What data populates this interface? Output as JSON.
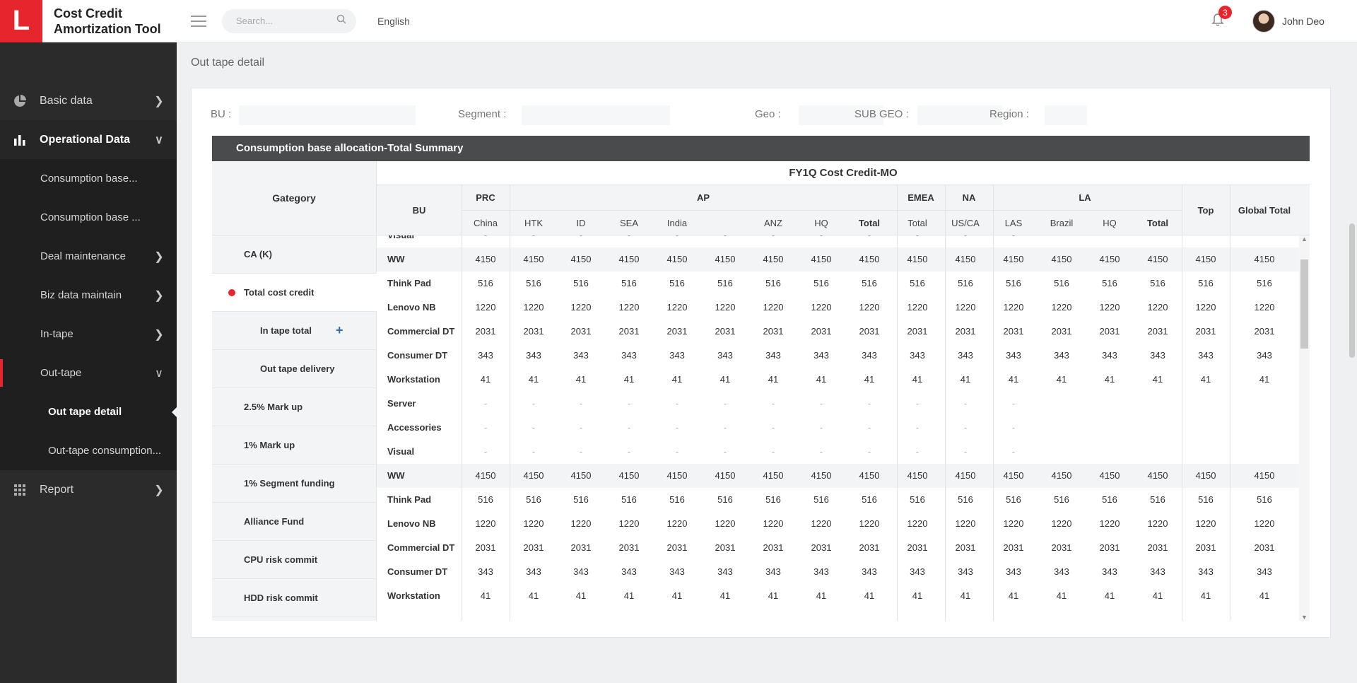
{
  "app": {
    "logo_letter": "L",
    "title": "Cost Credit Amortization Tool"
  },
  "topbar": {
    "search_placeholder": "Search...",
    "language": "English",
    "notifications": "3",
    "user_name": "John Deo"
  },
  "sidebar": {
    "basic_data": "Basic data",
    "operational_data": "Operational Data",
    "consumption_base_1": "Consumption base...",
    "consumption_base_2": "Consumption base ...",
    "deal_maintenance": "Deal maintenance",
    "biz_data_maintain": "Biz data maintain",
    "in_tape": "In-tape",
    "out_tape": "Out-tape",
    "out_tape_detail": "Out tape detail",
    "out_tape_consumption": "Out-tape consumption...",
    "report": "Report"
  },
  "page": {
    "title": "Out tape detail"
  },
  "filters": {
    "bu": "BU :",
    "segment": "Segment :",
    "geo": "Geo :",
    "sub_geo": "SUB GEO :",
    "region": "Region :"
  },
  "summary": {
    "title": "Consumption base allocation-Total Summary"
  },
  "categories": {
    "header": "Gategory",
    "items": [
      "CA (K)",
      "Total cost credit",
      "In tape total",
      "Out tape delivery",
      "2.5% Mark up",
      "1% Mark up",
      "1% Segment funding",
      "Alliance Fund",
      "CPU risk commit",
      "HDD risk commit"
    ],
    "add_symbol": "+"
  },
  "table": {
    "period_title": "FY1Q Cost Credit-MO",
    "bu_header": "BU",
    "group_headers": [
      "PRC",
      "AP",
      "EMEA",
      "NA",
      "LA"
    ],
    "top_header": "Top",
    "global_total_header": "Global Total",
    "sub_headers": [
      "China",
      "HTK",
      "ID",
      "SEA",
      "India",
      "ANZ",
      "HQ",
      "Total",
      "Total",
      "US/CA",
      "LAS",
      "Brazil",
      "HQ",
      "Total"
    ],
    "rows": [
      {
        "label": "Visual",
        "values": [
          "-",
          "-",
          "-",
          "-",
          "-",
          "-",
          "-",
          "-",
          "-",
          "-",
          "-",
          "-",
          "",
          "",
          "",
          "",
          "",
          ""
        ]
      },
      {
        "label": "WW",
        "ww": true,
        "values": [
          "4150",
          "4150",
          "4150",
          "4150",
          "4150",
          "4150",
          "4150",
          "4150",
          "4150",
          "4150",
          "4150",
          "4150",
          "4150",
          "4150",
          "4150",
          "4150",
          "4150"
        ]
      },
      {
        "label": "Think Pad",
        "values": [
          "516",
          "516",
          "516",
          "516",
          "516",
          "516",
          "516",
          "516",
          "516",
          "516",
          "516",
          "516",
          "516",
          "516",
          "516",
          "516",
          "516"
        ]
      },
      {
        "label": "Lenovo NB",
        "values": [
          "1220",
          "1220",
          "1220",
          "1220",
          "1220",
          "1220",
          "1220",
          "1220",
          "1220",
          "1220",
          "1220",
          "1220",
          "1220",
          "1220",
          "1220",
          "1220",
          "1220"
        ]
      },
      {
        "label": "Commercial DT",
        "values": [
          "2031",
          "2031",
          "2031",
          "2031",
          "2031",
          "2031",
          "2031",
          "2031",
          "2031",
          "2031",
          "2031",
          "2031",
          "2031",
          "2031",
          "2031",
          "2031",
          "2031"
        ]
      },
      {
        "label": "Consumer DT",
        "values": [
          "343",
          "343",
          "343",
          "343",
          "343",
          "343",
          "343",
          "343",
          "343",
          "343",
          "343",
          "343",
          "343",
          "343",
          "343",
          "343",
          "343"
        ]
      },
      {
        "label": "Workstation",
        "values": [
          "41",
          "41",
          "41",
          "41",
          "41",
          "41",
          "41",
          "41",
          "41",
          "41",
          "41",
          "41",
          "41",
          "41",
          "41",
          "41",
          "41"
        ]
      },
      {
        "label": "Server",
        "values": [
          "-",
          "-",
          "-",
          "-",
          "-",
          "-",
          "-",
          "-",
          "-",
          "-",
          "-",
          "-",
          "",
          "",
          "",
          "",
          ""
        ]
      },
      {
        "label": "Accessories",
        "values": [
          "-",
          "-",
          "-",
          "-",
          "-",
          "-",
          "-",
          "-",
          "-",
          "-",
          "-",
          "-",
          "",
          "",
          "",
          "",
          ""
        ]
      },
      {
        "label": "Visual",
        "values": [
          "-",
          "-",
          "-",
          "-",
          "-",
          "-",
          "-",
          "-",
          "-",
          "-",
          "-",
          "-",
          "",
          "",
          "",
          "",
          ""
        ]
      },
      {
        "label": "WW",
        "ww": true,
        "values": [
          "4150",
          "4150",
          "4150",
          "4150",
          "4150",
          "4150",
          "4150",
          "4150",
          "4150",
          "4150",
          "4150",
          "4150",
          "4150",
          "4150",
          "4150",
          "4150",
          "4150"
        ]
      },
      {
        "label": "Think Pad",
        "values": [
          "516",
          "516",
          "516",
          "516",
          "516",
          "516",
          "516",
          "516",
          "516",
          "516",
          "516",
          "516",
          "516",
          "516",
          "516",
          "516",
          "516"
        ]
      },
      {
        "label": "Lenovo NB",
        "values": [
          "1220",
          "1220",
          "1220",
          "1220",
          "1220",
          "1220",
          "1220",
          "1220",
          "1220",
          "1220",
          "1220",
          "1220",
          "1220",
          "1220",
          "1220",
          "1220",
          "1220"
        ]
      },
      {
        "label": "Commercial DT",
        "values": [
          "2031",
          "2031",
          "2031",
          "2031",
          "2031",
          "2031",
          "2031",
          "2031",
          "2031",
          "2031",
          "2031",
          "2031",
          "2031",
          "2031",
          "2031",
          "2031",
          "2031"
        ]
      },
      {
        "label": "Consumer DT",
        "values": [
          "343",
          "343",
          "343",
          "343",
          "343",
          "343",
          "343",
          "343",
          "343",
          "343",
          "343",
          "343",
          "343",
          "343",
          "343",
          "343",
          "343"
        ]
      },
      {
        "label": "Workstation",
        "values": [
          "41",
          "41",
          "41",
          "41",
          "41",
          "41",
          "41",
          "41",
          "41",
          "41",
          "41",
          "41",
          "41",
          "41",
          "41",
          "41",
          "41"
        ]
      }
    ]
  },
  "colors": {
    "accent": "#e6262c",
    "sidebar_bg": "#2b2b2b",
    "header_bar": "#4a4b4d",
    "plus": "#2b6cb0"
  },
  "icons": {
    "basic_data": "pie-chart-icon",
    "operational_data": "bar-chart-icon",
    "report": "grid-icon",
    "search": "search-icon",
    "bell": "bell-icon"
  }
}
